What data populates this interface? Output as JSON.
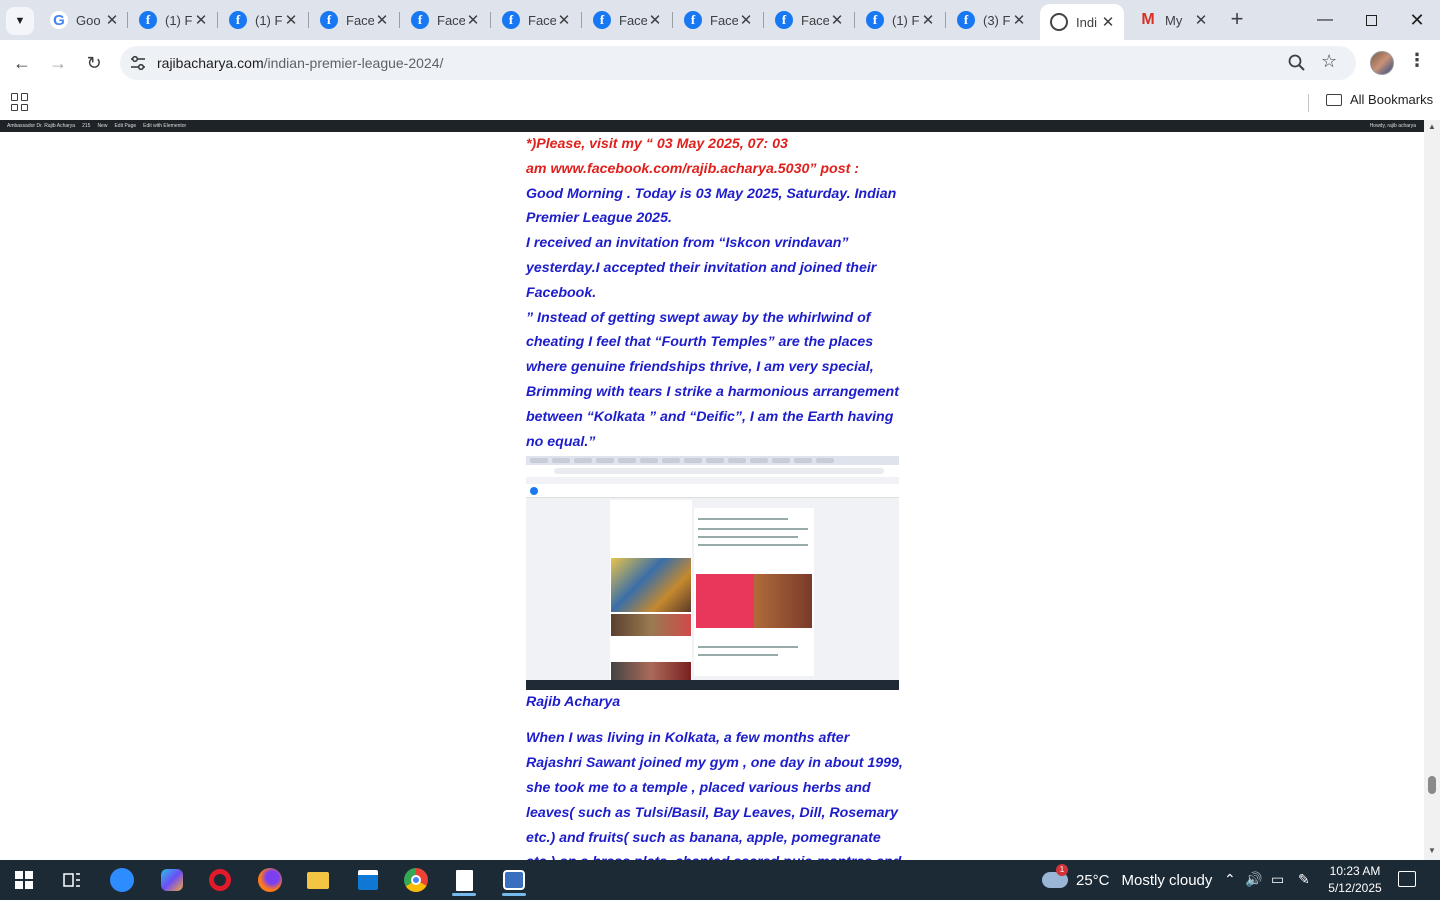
{
  "browser": {
    "tabs": [
      {
        "icon": "google-favicon",
        "title": "Goo"
      },
      {
        "icon": "facebook-favicon",
        "title": "(1) F"
      },
      {
        "icon": "facebook-favicon",
        "title": "(1) F"
      },
      {
        "icon": "facebook-favicon",
        "title": "Face"
      },
      {
        "icon": "facebook-favicon",
        "title": "Face"
      },
      {
        "icon": "facebook-favicon",
        "title": "Face"
      },
      {
        "icon": "facebook-favicon",
        "title": "Face"
      },
      {
        "icon": "facebook-favicon",
        "title": "Face"
      },
      {
        "icon": "facebook-favicon",
        "title": "Face"
      },
      {
        "icon": "facebook-favicon",
        "title": "(1) F"
      },
      {
        "icon": "facebook-favicon",
        "title": "(3) F"
      },
      {
        "icon": "globe-favicon",
        "title": "Indi",
        "active": true
      },
      {
        "icon": "gmail-favicon",
        "title": "My"
      }
    ],
    "url_host": "rajibacharya.com",
    "url_path": "/indian-premier-league-2024/",
    "bookmarks_label": "All Bookmarks"
  },
  "admin_bar": {
    "items": [
      "Ambassador Dr. Rajib Acharya",
      "215",
      "New",
      "Edit Page",
      "Edit with Elementor"
    ],
    "greeting": "Howdy, rajib acharya"
  },
  "article": {
    "intro_red_1": "*)Please, visit my “  03 May 2025, 07: 03",
    "intro_red_2": "am  www.facebook.com/rajib.acharya.5030” post :",
    "para_1": "Good Morning . Today is 03 May 2025, Saturday. Indian Premier League 2025.",
    "para_2": "I received an invitation from “Iskcon vrindavan” yesterday.I accepted their invitation and joined their Facebook.",
    "para_3": "” Instead of getting swept away by the whirlwind of cheating I feel that “Fourth Temples” are the places where genuine friendships thrive, I am very special,",
    "para_4": "Brimming with tears I strike a harmonious arrangement between “Kolkata ” and “Deific”, I am the Earth having no equal.”",
    "caption": "Rajib Acharya",
    "para_5": "When I was living in Kolkata, a few months after Rajashri Sawant joined my gym , one day in about 1999, she took me to a temple , placed various herbs and leaves( such as Tulsi/Basil, Bay Leaves, Dill, Rosemary etc.) and fruits( such as banana, apple, pomegranate etc.) on a brass plate, chanted sacred puja-mantras and married me ."
  },
  "taskbar": {
    "apps": [
      "windows-start-icon",
      "task-view-icon",
      "zoom-icon",
      "copilot-icon",
      "opera-icon",
      "firefox-icon",
      "file-explorer-icon",
      "microsoft-store-icon",
      "chrome-icon",
      "notepad-icon",
      "snipping-tool-icon"
    ],
    "weather_badge": "1",
    "temperature": "25°C",
    "weather": "Mostly cloudy",
    "time": "10:23 AM",
    "date": "5/12/2025"
  },
  "colors": {
    "article_text": "#1d1dcc",
    "article_highlight": "#e0201c",
    "admin_bar": "#1d2327",
    "taskbar": "#1c2a36",
    "tabstrip": "#dfe3eb"
  }
}
